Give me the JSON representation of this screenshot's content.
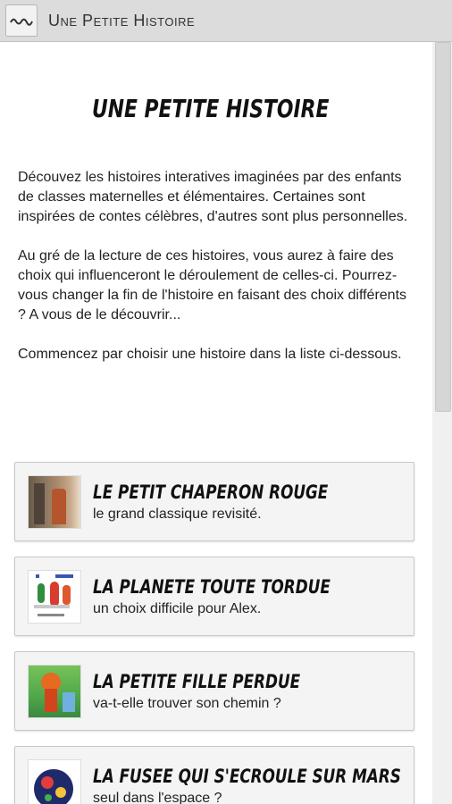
{
  "app_bar": {
    "title": "Une Petite Histoire",
    "icon": "app-logo-icon"
  },
  "page": {
    "title": "UNE PETITE HISTOIRE",
    "intro": [
      "Découvez les histoires interatives imaginées par des enfants de classes maternelles et élémentaires. Certaines sont inspirées de contes célèbres, d'autres sont plus personnelles.",
      "Au gré de la lecture de ces histoires, vous aurez à faire des choix qui influenceront le déroulement de celles-ci. Pourrez-vous changer la fin de l'histoire en faisant des choix différents ? A vous de le découvrir...",
      "Commencez par choisir une histoire dans la liste ci-dessous."
    ]
  },
  "stories": [
    {
      "title": "LE PETIT CHAPERON ROUGE",
      "subtitle": "le grand classique revisité."
    },
    {
      "title": "LA PLANETE TOUTE TORDUE",
      "subtitle": "un choix difficile pour Alex."
    },
    {
      "title": "LA PETITE FILLE PERDUE",
      "subtitle": "va-t-elle trouver son chemin ?"
    },
    {
      "title": "LA FUSEE QUI S'ECROULE SUR MARS",
      "subtitle": "seul dans l'espace ?"
    }
  ]
}
